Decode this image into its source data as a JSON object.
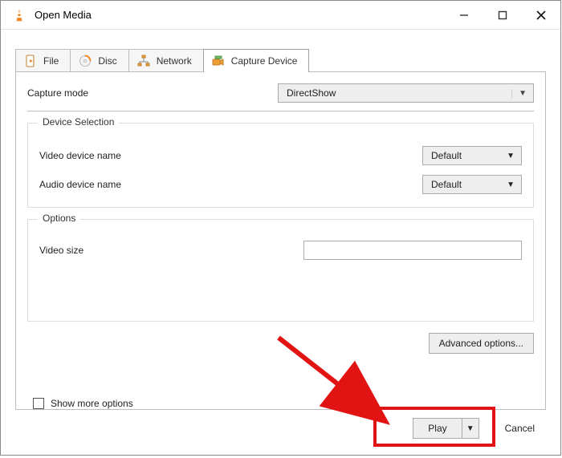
{
  "window": {
    "title": "Open Media"
  },
  "tabs": {
    "file": "File",
    "disc": "Disc",
    "network": "Network",
    "capture": "Capture Device"
  },
  "capture": {
    "mode_label": "Capture mode",
    "mode_value": "DirectShow",
    "device_selection": {
      "legend": "Device Selection",
      "video_label": "Video device name",
      "video_value": "Default",
      "audio_label": "Audio device name",
      "audio_value": "Default"
    },
    "options": {
      "legend": "Options",
      "video_size_label": "Video size",
      "video_size_value": ""
    },
    "advanced_btn": "Advanced options..."
  },
  "footer": {
    "show_more": "Show more options",
    "play": "Play",
    "cancel": "Cancel"
  }
}
